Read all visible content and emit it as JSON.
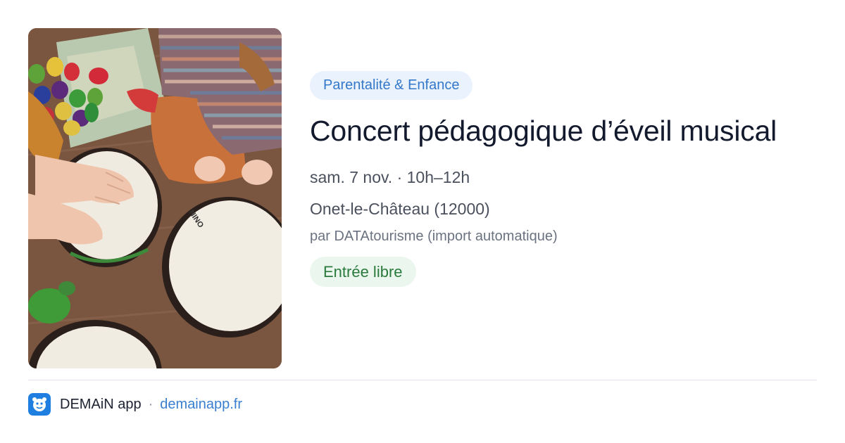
{
  "event": {
    "category": "Parentalité & Enfance",
    "title": "Concert pédagogique d’éveil musical",
    "datetime": "sam. 7 nov. · 10h–12h",
    "location": "Onet-le-Château (12000)",
    "source": "par DATAtourisme (import automatique)",
    "price": "Entrée libre"
  },
  "footer": {
    "app_name": "DEMAiN app",
    "separator": "·",
    "domain": "demainapp.fr"
  },
  "colors": {
    "category_bg": "#eaf2fd",
    "category_text": "#3478c9",
    "price_bg": "#ebf7ee",
    "price_text": "#2a7a3e",
    "link": "#3a7fcf",
    "logo": "#1f7fe0"
  }
}
